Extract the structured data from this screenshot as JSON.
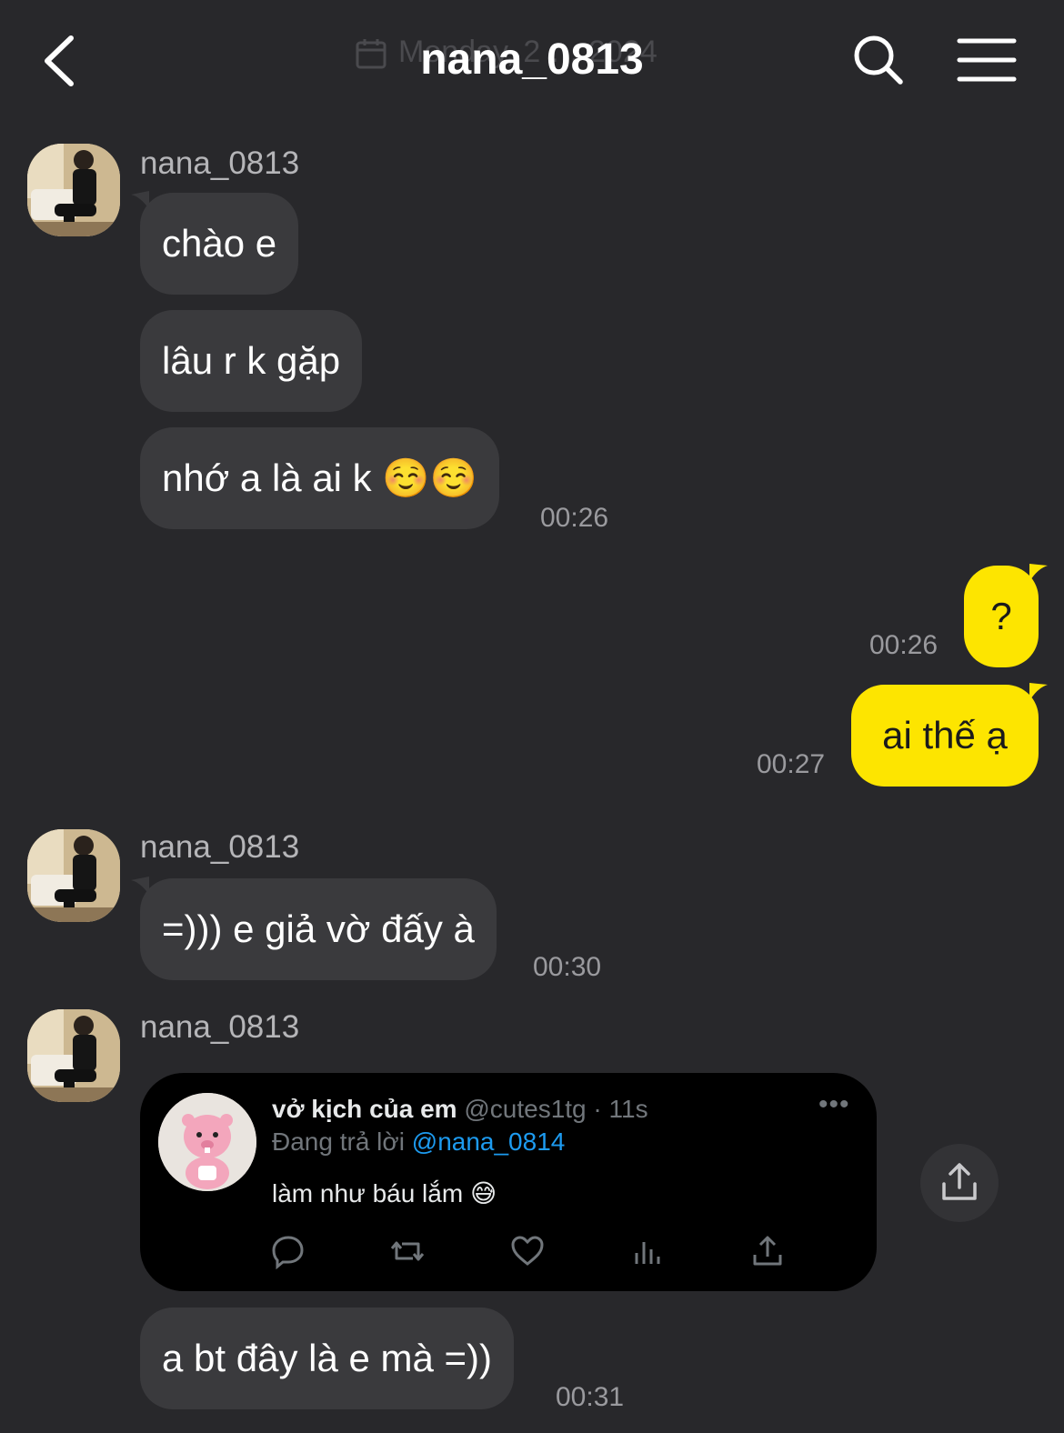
{
  "header": {
    "title": "nana_0813",
    "date_behind_title": "Monday, 2 … 2024"
  },
  "messages": [
    {
      "id": "m1",
      "sender": "nana_0813",
      "text": "chào e"
    },
    {
      "id": "m2",
      "text": "lâu r k gặp"
    },
    {
      "id": "m3",
      "text": "nhớ a là ai k ☺️☺️",
      "time": "00:26"
    },
    {
      "id": "m4",
      "direction": "out",
      "text": "?",
      "time": "00:26"
    },
    {
      "id": "m5",
      "direction": "out",
      "text": "ai thế ạ",
      "time": "00:27"
    },
    {
      "id": "m6",
      "sender": "nana_0813",
      "text": "=))) e giả vờ đấy à",
      "time": "00:30"
    },
    {
      "id": "m7",
      "sender": "nana_0813",
      "type": "shared-tweet"
    },
    {
      "id": "m8",
      "text": "a bt đây là e mà =))",
      "time": "00:31"
    }
  ],
  "tweet": {
    "display_name": "vở kịch của em",
    "handle_time": " @cutes1tg · 11s",
    "replying_prefix": "Đang trả lời ",
    "replying_to": "@nana_0814",
    "body": "làm như báu lắm 😅",
    "more": "•••",
    "actions": [
      "reply-icon",
      "retweet-icon",
      "like-icon",
      "views-icon",
      "share-icon"
    ]
  },
  "colors": {
    "background": "#28282b",
    "incoming_bubble": "#3a3a3d",
    "outgoing_bubble": "#fde500",
    "timestamp": "#9a9a9e",
    "mention": "#1d9bf0"
  },
  "icons": {
    "back": "chevron-left-icon",
    "search": "search-icon",
    "menu": "hamburger-menu-icon",
    "share": "share-icon"
  }
}
